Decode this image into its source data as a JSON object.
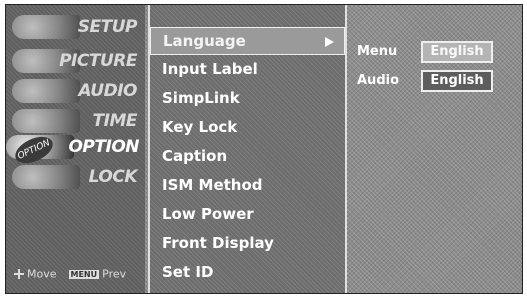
{
  "categories": [
    {
      "label": "SETUP",
      "icon": "setup-icon"
    },
    {
      "label": "PICTURE",
      "icon": "picture-icon"
    },
    {
      "label": "AUDIO",
      "icon": "audio-icon"
    },
    {
      "label": "TIME",
      "icon": "time-icon"
    },
    {
      "label": "OPTION",
      "icon": "option-icon",
      "active": true,
      "badge": "OPTION"
    },
    {
      "label": "LOCK",
      "icon": "lock-icon"
    }
  ],
  "footer": {
    "move_label": "Move",
    "menu_key": "MENU",
    "prev_label": "Prev"
  },
  "option_items": [
    {
      "label": "Language",
      "selected": true
    },
    {
      "label": "Input Label"
    },
    {
      "label": "SimpLink"
    },
    {
      "label": "Key Lock"
    },
    {
      "label": "Caption"
    },
    {
      "label": "ISM Method"
    },
    {
      "label": "Low Power"
    },
    {
      "label": "Front Display"
    },
    {
      "label": "Set ID"
    }
  ],
  "language_submenu": {
    "menu": {
      "label": "Menu",
      "value": "English"
    },
    "audio": {
      "label": "Audio",
      "value": "English"
    }
  },
  "colors": {
    "panel": "#6c6c6c",
    "highlight": "#9a9a9a",
    "text": "#ffffff"
  }
}
